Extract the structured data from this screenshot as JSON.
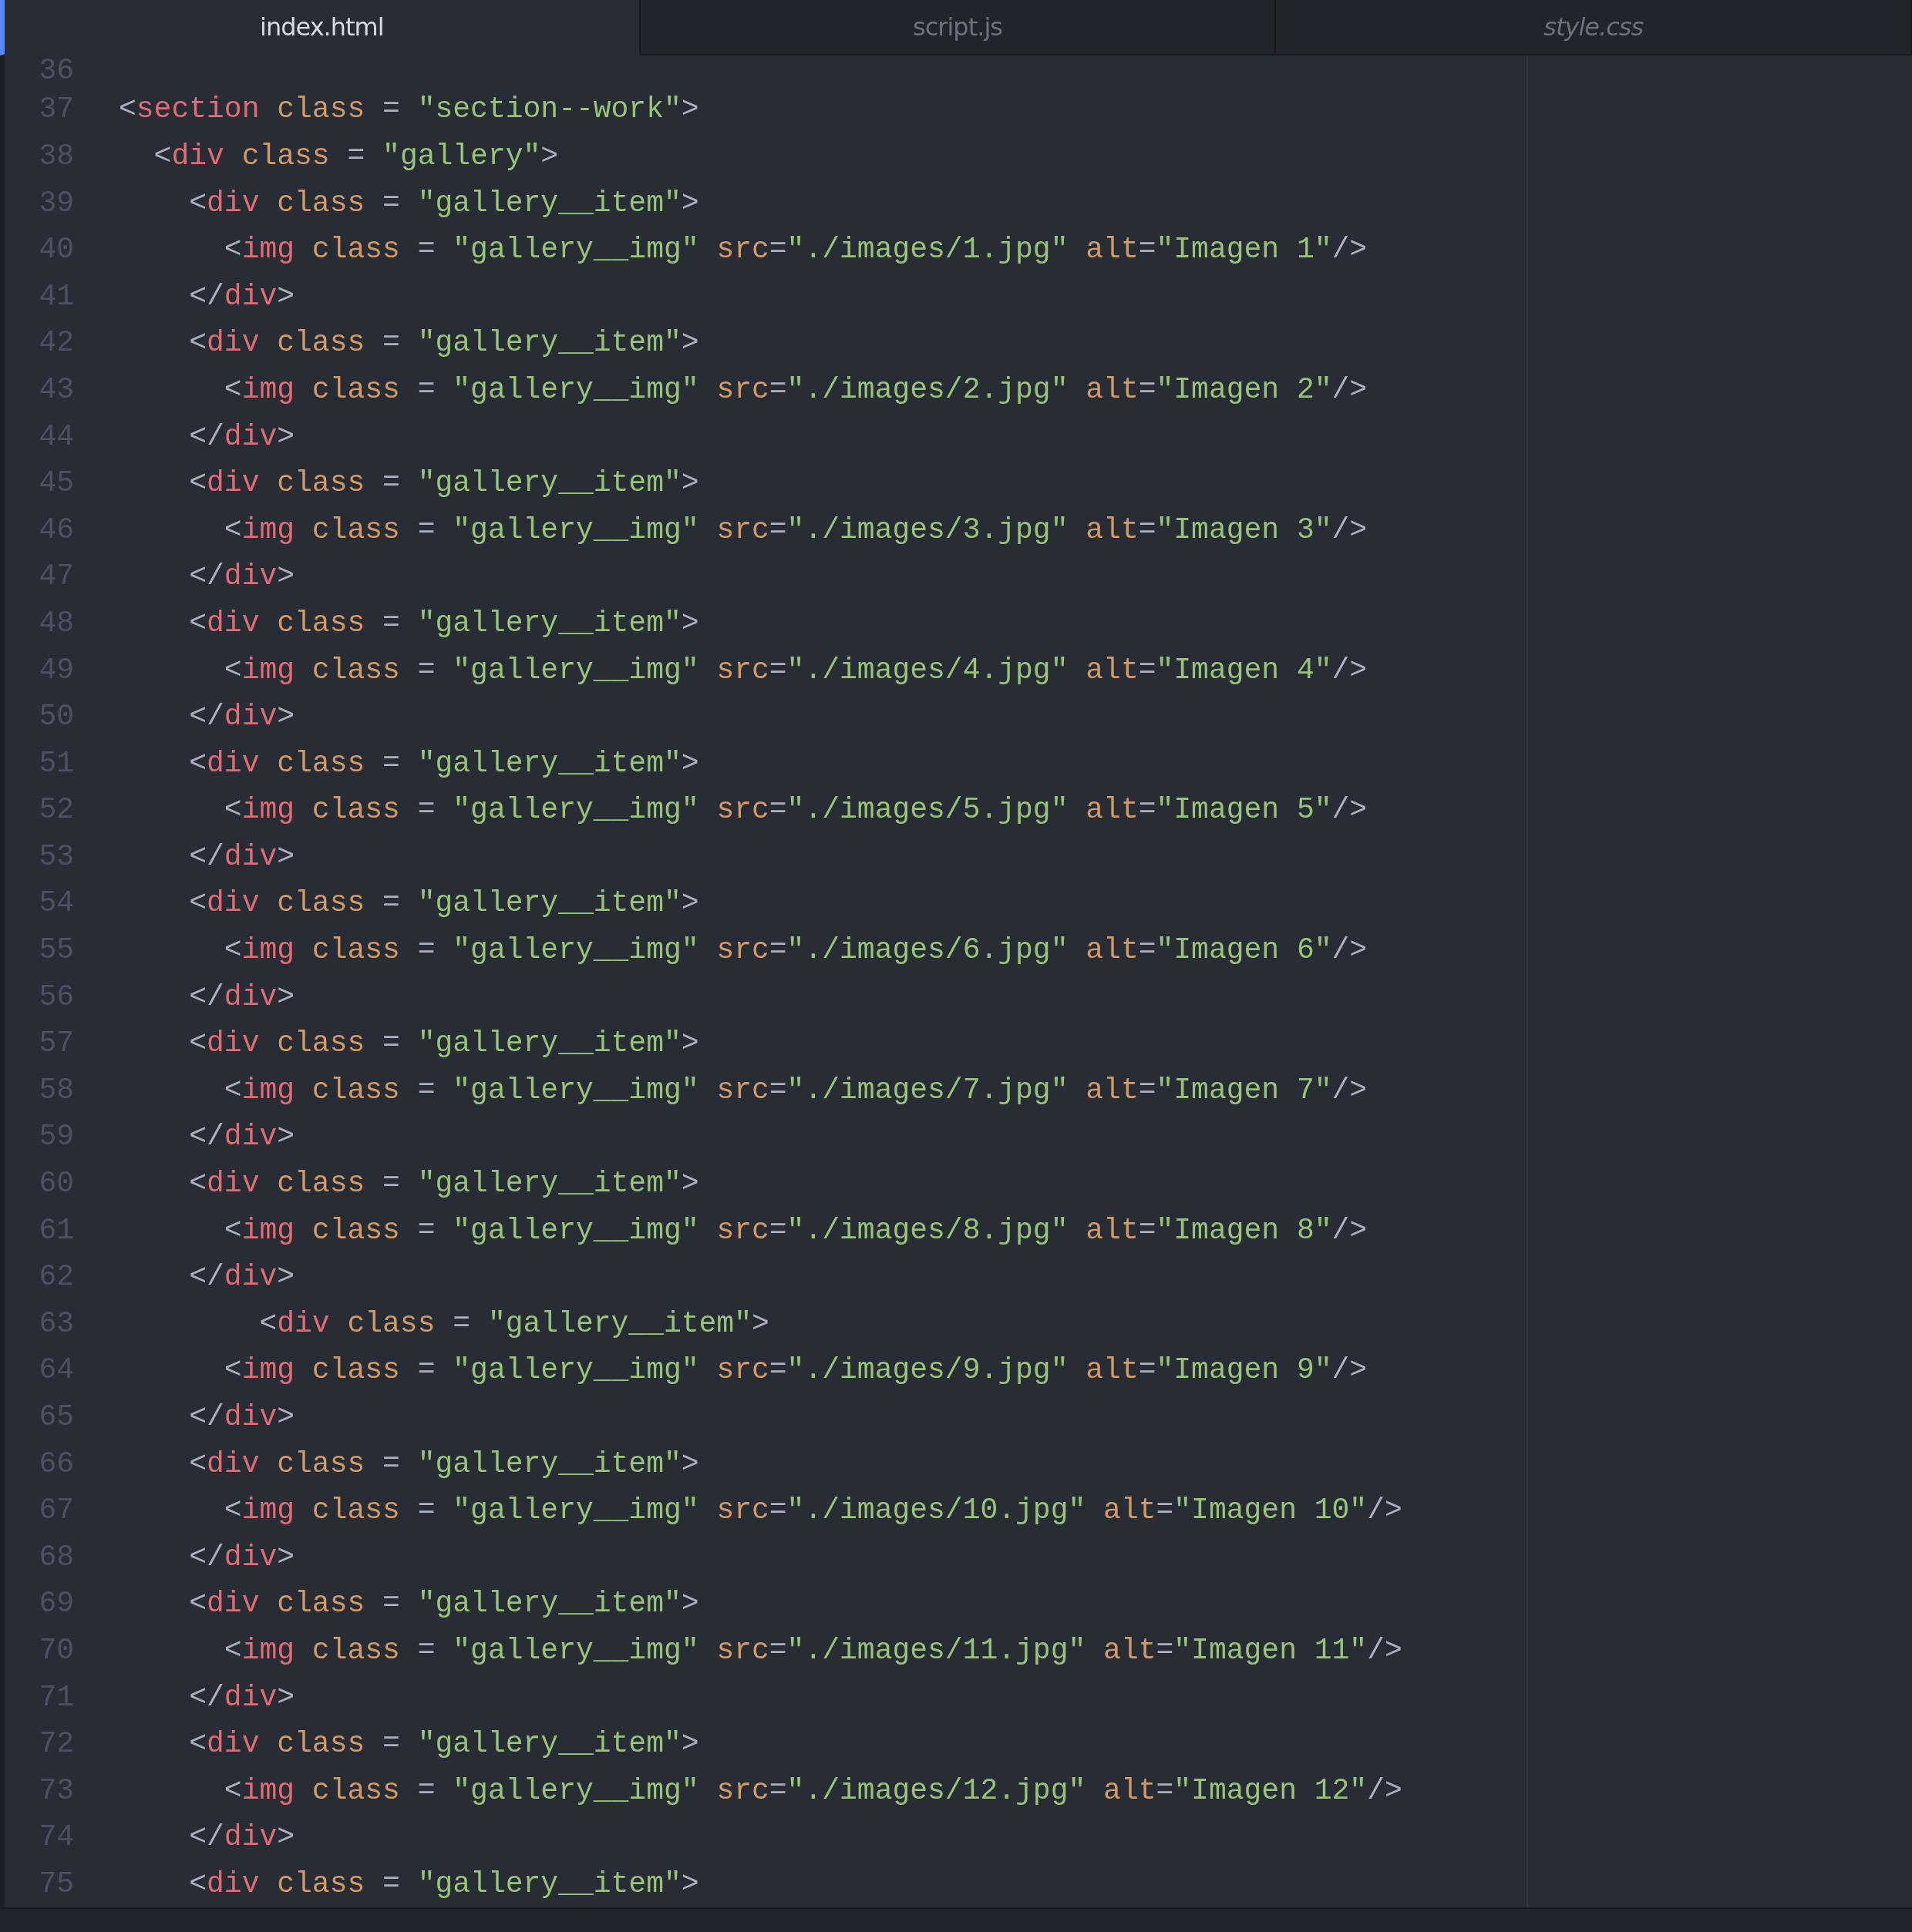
{
  "tabs": [
    {
      "label": "index.html",
      "selected": true,
      "pending": false
    },
    {
      "label": "script.js",
      "selected": false,
      "pending": false
    },
    {
      "label": "style.css",
      "selected": false,
      "pending": true
    }
  ],
  "editor": {
    "lines": [
      {
        "number": "36"
      },
      {
        "number": "37",
        "tokens": [
          {
            "kind": "punct",
            "text": "<"
          },
          {
            "kind": "tag",
            "text": "section"
          },
          {
            "kind": "attr",
            "text": " class"
          },
          {
            "kind": "punct",
            "text": " = "
          },
          {
            "kind": "string",
            "text": "\"section--work\""
          },
          {
            "kind": "punct",
            "text": ">"
          }
        ]
      },
      {
        "number": "38",
        "tokens": [
          {
            "kind": "punct",
            "text": "  <"
          },
          {
            "kind": "tag",
            "text": "div"
          },
          {
            "kind": "attr",
            "text": " class"
          },
          {
            "kind": "punct",
            "text": " = "
          },
          {
            "kind": "string",
            "text": "\"gallery\""
          },
          {
            "kind": "punct",
            "text": ">"
          }
        ]
      },
      {
        "number": "39",
        "tokens": [
          {
            "kind": "punct",
            "text": "    <"
          },
          {
            "kind": "tag",
            "text": "div"
          },
          {
            "kind": "attr",
            "text": " class"
          },
          {
            "kind": "punct",
            "text": " = "
          },
          {
            "kind": "string",
            "text": "\"gallery__item\""
          },
          {
            "kind": "punct",
            "text": ">"
          }
        ]
      },
      {
        "number": "40",
        "tokens": [
          {
            "kind": "punct",
            "text": "      <"
          },
          {
            "kind": "tag",
            "text": "img"
          },
          {
            "kind": "attr",
            "text": " class"
          },
          {
            "kind": "punct",
            "text": " = "
          },
          {
            "kind": "string",
            "text": "\"gallery__img\""
          },
          {
            "kind": "attr",
            "text": " src"
          },
          {
            "kind": "punct",
            "text": "="
          },
          {
            "kind": "string",
            "text": "\"./images/1.jpg\""
          },
          {
            "kind": "attr",
            "text": " alt"
          },
          {
            "kind": "punct",
            "text": "="
          },
          {
            "kind": "string",
            "text": "\"Imagen 1\""
          },
          {
            "kind": "punct",
            "text": "/>"
          }
        ]
      },
      {
        "number": "41",
        "tokens": [
          {
            "kind": "punct",
            "text": "    </"
          },
          {
            "kind": "tag",
            "text": "div"
          },
          {
            "kind": "punct",
            "text": ">"
          }
        ]
      },
      {
        "number": "42",
        "tokens": [
          {
            "kind": "punct",
            "text": "    <"
          },
          {
            "kind": "tag",
            "text": "div"
          },
          {
            "kind": "attr",
            "text": " class"
          },
          {
            "kind": "punct",
            "text": " = "
          },
          {
            "kind": "string",
            "text": "\"gallery__item\""
          },
          {
            "kind": "punct",
            "text": ">"
          }
        ]
      },
      {
        "number": "43",
        "tokens": [
          {
            "kind": "punct",
            "text": "      <"
          },
          {
            "kind": "tag",
            "text": "img"
          },
          {
            "kind": "attr",
            "text": " class"
          },
          {
            "kind": "punct",
            "text": " = "
          },
          {
            "kind": "string",
            "text": "\"gallery__img\""
          },
          {
            "kind": "attr",
            "text": " src"
          },
          {
            "kind": "punct",
            "text": "="
          },
          {
            "kind": "string",
            "text": "\"./images/2.jpg\""
          },
          {
            "kind": "attr",
            "text": " alt"
          },
          {
            "kind": "punct",
            "text": "="
          },
          {
            "kind": "string",
            "text": "\"Imagen 2\""
          },
          {
            "kind": "punct",
            "text": "/>"
          }
        ]
      },
      {
        "number": "44",
        "tokens": [
          {
            "kind": "punct",
            "text": "    </"
          },
          {
            "kind": "tag",
            "text": "div"
          },
          {
            "kind": "punct",
            "text": ">"
          }
        ]
      },
      {
        "number": "45",
        "tokens": [
          {
            "kind": "punct",
            "text": "    <"
          },
          {
            "kind": "tag",
            "text": "div"
          },
          {
            "kind": "attr",
            "text": " class"
          },
          {
            "kind": "punct",
            "text": " = "
          },
          {
            "kind": "string",
            "text": "\"gallery__item\""
          },
          {
            "kind": "punct",
            "text": ">"
          }
        ]
      },
      {
        "number": "46",
        "tokens": [
          {
            "kind": "punct",
            "text": "      <"
          },
          {
            "kind": "tag",
            "text": "img"
          },
          {
            "kind": "attr",
            "text": " class"
          },
          {
            "kind": "punct",
            "text": " = "
          },
          {
            "kind": "string",
            "text": "\"gallery__img\""
          },
          {
            "kind": "attr",
            "text": " src"
          },
          {
            "kind": "punct",
            "text": "="
          },
          {
            "kind": "string",
            "text": "\"./images/3.jpg\""
          },
          {
            "kind": "attr",
            "text": " alt"
          },
          {
            "kind": "punct",
            "text": "="
          },
          {
            "kind": "string",
            "text": "\"Imagen 3\""
          },
          {
            "kind": "punct",
            "text": "/>"
          }
        ]
      },
      {
        "number": "47",
        "tokens": [
          {
            "kind": "punct",
            "text": "    </"
          },
          {
            "kind": "tag",
            "text": "div"
          },
          {
            "kind": "punct",
            "text": ">"
          }
        ]
      },
      {
        "number": "48",
        "tokens": [
          {
            "kind": "punct",
            "text": "    <"
          },
          {
            "kind": "tag",
            "text": "div"
          },
          {
            "kind": "attr",
            "text": " class"
          },
          {
            "kind": "punct",
            "text": " = "
          },
          {
            "kind": "string",
            "text": "\"gallery__item\""
          },
          {
            "kind": "punct",
            "text": ">"
          }
        ]
      },
      {
        "number": "49",
        "tokens": [
          {
            "kind": "punct",
            "text": "      <"
          },
          {
            "kind": "tag",
            "text": "img"
          },
          {
            "kind": "attr",
            "text": " class"
          },
          {
            "kind": "punct",
            "text": " = "
          },
          {
            "kind": "string",
            "text": "\"gallery__img\""
          },
          {
            "kind": "attr",
            "text": " src"
          },
          {
            "kind": "punct",
            "text": "="
          },
          {
            "kind": "string",
            "text": "\"./images/4.jpg\""
          },
          {
            "kind": "attr",
            "text": " alt"
          },
          {
            "kind": "punct",
            "text": "="
          },
          {
            "kind": "string",
            "text": "\"Imagen 4\""
          },
          {
            "kind": "punct",
            "text": "/>"
          }
        ]
      },
      {
        "number": "50",
        "tokens": [
          {
            "kind": "punct",
            "text": "    </"
          },
          {
            "kind": "tag",
            "text": "div"
          },
          {
            "kind": "punct",
            "text": ">"
          }
        ]
      },
      {
        "number": "51",
        "tokens": [
          {
            "kind": "punct",
            "text": "    <"
          },
          {
            "kind": "tag",
            "text": "div"
          },
          {
            "kind": "attr",
            "text": " class"
          },
          {
            "kind": "punct",
            "text": " = "
          },
          {
            "kind": "string",
            "text": "\"gallery__item\""
          },
          {
            "kind": "punct",
            "text": ">"
          }
        ]
      },
      {
        "number": "52",
        "tokens": [
          {
            "kind": "punct",
            "text": "      <"
          },
          {
            "kind": "tag",
            "text": "img"
          },
          {
            "kind": "attr",
            "text": " class"
          },
          {
            "kind": "punct",
            "text": " = "
          },
          {
            "kind": "string",
            "text": "\"gallery__img\""
          },
          {
            "kind": "attr",
            "text": " src"
          },
          {
            "kind": "punct",
            "text": "="
          },
          {
            "kind": "string",
            "text": "\"./images/5.jpg\""
          },
          {
            "kind": "attr",
            "text": " alt"
          },
          {
            "kind": "punct",
            "text": "="
          },
          {
            "kind": "string",
            "text": "\"Imagen 5\""
          },
          {
            "kind": "punct",
            "text": "/>"
          }
        ]
      },
      {
        "number": "53",
        "tokens": [
          {
            "kind": "punct",
            "text": "    </"
          },
          {
            "kind": "tag",
            "text": "div"
          },
          {
            "kind": "punct",
            "text": ">"
          }
        ]
      },
      {
        "number": "54",
        "tokens": [
          {
            "kind": "punct",
            "text": "    <"
          },
          {
            "kind": "tag",
            "text": "div"
          },
          {
            "kind": "attr",
            "text": " class"
          },
          {
            "kind": "punct",
            "text": " = "
          },
          {
            "kind": "string",
            "text": "\"gallery__item\""
          },
          {
            "kind": "punct",
            "text": ">"
          }
        ]
      },
      {
        "number": "55",
        "tokens": [
          {
            "kind": "punct",
            "text": "      <"
          },
          {
            "kind": "tag",
            "text": "img"
          },
          {
            "kind": "attr",
            "text": " class"
          },
          {
            "kind": "punct",
            "text": " = "
          },
          {
            "kind": "string",
            "text": "\"gallery__img\""
          },
          {
            "kind": "attr",
            "text": " src"
          },
          {
            "kind": "punct",
            "text": "="
          },
          {
            "kind": "string",
            "text": "\"./images/6.jpg\""
          },
          {
            "kind": "attr",
            "text": " alt"
          },
          {
            "kind": "punct",
            "text": "="
          },
          {
            "kind": "string",
            "text": "\"Imagen 6\""
          },
          {
            "kind": "punct",
            "text": "/>"
          }
        ]
      },
      {
        "number": "56",
        "tokens": [
          {
            "kind": "punct",
            "text": "    </"
          },
          {
            "kind": "tag",
            "text": "div"
          },
          {
            "kind": "punct",
            "text": ">"
          }
        ]
      },
      {
        "number": "57",
        "tokens": [
          {
            "kind": "punct",
            "text": "    <"
          },
          {
            "kind": "tag",
            "text": "div"
          },
          {
            "kind": "attr",
            "text": " class"
          },
          {
            "kind": "punct",
            "text": " = "
          },
          {
            "kind": "string",
            "text": "\"gallery__item\""
          },
          {
            "kind": "punct",
            "text": ">"
          }
        ]
      },
      {
        "number": "58",
        "tokens": [
          {
            "kind": "punct",
            "text": "      <"
          },
          {
            "kind": "tag",
            "text": "img"
          },
          {
            "kind": "attr",
            "text": " class"
          },
          {
            "kind": "punct",
            "text": " = "
          },
          {
            "kind": "string",
            "text": "\"gallery__img\""
          },
          {
            "kind": "attr",
            "text": " src"
          },
          {
            "kind": "punct",
            "text": "="
          },
          {
            "kind": "string",
            "text": "\"./images/7.jpg\""
          },
          {
            "kind": "attr",
            "text": " alt"
          },
          {
            "kind": "punct",
            "text": "="
          },
          {
            "kind": "string",
            "text": "\"Imagen 7\""
          },
          {
            "kind": "punct",
            "text": "/>"
          }
        ]
      },
      {
        "number": "59",
        "tokens": [
          {
            "kind": "punct",
            "text": "    </"
          },
          {
            "kind": "tag",
            "text": "div"
          },
          {
            "kind": "punct",
            "text": ">"
          }
        ]
      },
      {
        "number": "60",
        "tokens": [
          {
            "kind": "punct",
            "text": "    <"
          },
          {
            "kind": "tag",
            "text": "div"
          },
          {
            "kind": "attr",
            "text": " class"
          },
          {
            "kind": "punct",
            "text": " = "
          },
          {
            "kind": "string",
            "text": "\"gallery__item\""
          },
          {
            "kind": "punct",
            "text": ">"
          }
        ]
      },
      {
        "number": "61",
        "tokens": [
          {
            "kind": "punct",
            "text": "      <"
          },
          {
            "kind": "tag",
            "text": "img"
          },
          {
            "kind": "attr",
            "text": " class"
          },
          {
            "kind": "punct",
            "text": " = "
          },
          {
            "kind": "string",
            "text": "\"gallery__img\""
          },
          {
            "kind": "attr",
            "text": " src"
          },
          {
            "kind": "punct",
            "text": "="
          },
          {
            "kind": "string",
            "text": "\"./images/8.jpg\""
          },
          {
            "kind": "attr",
            "text": " alt"
          },
          {
            "kind": "punct",
            "text": "="
          },
          {
            "kind": "string",
            "text": "\"Imagen 8\""
          },
          {
            "kind": "punct",
            "text": "/>"
          }
        ]
      },
      {
        "number": "62",
        "tokens": [
          {
            "kind": "punct",
            "text": "    </"
          },
          {
            "kind": "tag",
            "text": "div"
          },
          {
            "kind": "punct",
            "text": ">"
          }
        ]
      },
      {
        "number": "63",
        "tokens": [
          {
            "kind": "punct",
            "text": "        <"
          },
          {
            "kind": "tag",
            "text": "div"
          },
          {
            "kind": "attr",
            "text": " class"
          },
          {
            "kind": "punct",
            "text": " = "
          },
          {
            "kind": "string",
            "text": "\"gallery__item\""
          },
          {
            "kind": "punct",
            "text": ">"
          }
        ]
      },
      {
        "number": "64",
        "tokens": [
          {
            "kind": "punct",
            "text": "      <"
          },
          {
            "kind": "tag",
            "text": "img"
          },
          {
            "kind": "attr",
            "text": " class"
          },
          {
            "kind": "punct",
            "text": " = "
          },
          {
            "kind": "string",
            "text": "\"gallery__img\""
          },
          {
            "kind": "attr",
            "text": " src"
          },
          {
            "kind": "punct",
            "text": "="
          },
          {
            "kind": "string",
            "text": "\"./images/9.jpg\""
          },
          {
            "kind": "attr",
            "text": " alt"
          },
          {
            "kind": "punct",
            "text": "="
          },
          {
            "kind": "string",
            "text": "\"Imagen 9\""
          },
          {
            "kind": "punct",
            "text": "/>"
          }
        ]
      },
      {
        "number": "65",
        "tokens": [
          {
            "kind": "punct",
            "text": "    </"
          },
          {
            "kind": "tag",
            "text": "div"
          },
          {
            "kind": "punct",
            "text": ">"
          }
        ]
      },
      {
        "number": "66",
        "tokens": [
          {
            "kind": "punct",
            "text": "    <"
          },
          {
            "kind": "tag",
            "text": "div"
          },
          {
            "kind": "attr",
            "text": " class"
          },
          {
            "kind": "punct",
            "text": " = "
          },
          {
            "kind": "string",
            "text": "\"gallery__item\""
          },
          {
            "kind": "punct",
            "text": ">"
          }
        ]
      },
      {
        "number": "67",
        "tokens": [
          {
            "kind": "punct",
            "text": "      <"
          },
          {
            "kind": "tag",
            "text": "img"
          },
          {
            "kind": "attr",
            "text": " class"
          },
          {
            "kind": "punct",
            "text": " = "
          },
          {
            "kind": "string",
            "text": "\"gallery__img\""
          },
          {
            "kind": "attr",
            "text": " src"
          },
          {
            "kind": "punct",
            "text": "="
          },
          {
            "kind": "string",
            "text": "\"./images/10.jpg\""
          },
          {
            "kind": "attr",
            "text": " alt"
          },
          {
            "kind": "punct",
            "text": "="
          },
          {
            "kind": "string",
            "text": "\"Imagen 10\""
          },
          {
            "kind": "punct",
            "text": "/>"
          }
        ]
      },
      {
        "number": "68",
        "tokens": [
          {
            "kind": "punct",
            "text": "    </"
          },
          {
            "kind": "tag",
            "text": "div"
          },
          {
            "kind": "punct",
            "text": ">"
          }
        ]
      },
      {
        "number": "69",
        "tokens": [
          {
            "kind": "punct",
            "text": "    <"
          },
          {
            "kind": "tag",
            "text": "div"
          },
          {
            "kind": "attr",
            "text": " class"
          },
          {
            "kind": "punct",
            "text": " = "
          },
          {
            "kind": "string",
            "text": "\"gallery__item\""
          },
          {
            "kind": "punct",
            "text": ">"
          }
        ]
      },
      {
        "number": "70",
        "tokens": [
          {
            "kind": "punct",
            "text": "      <"
          },
          {
            "kind": "tag",
            "text": "img"
          },
          {
            "kind": "attr",
            "text": " class"
          },
          {
            "kind": "punct",
            "text": " = "
          },
          {
            "kind": "string",
            "text": "\"gallery__img\""
          },
          {
            "kind": "attr",
            "text": " src"
          },
          {
            "kind": "punct",
            "text": "="
          },
          {
            "kind": "string",
            "text": "\"./images/11.jpg\""
          },
          {
            "kind": "attr",
            "text": " alt"
          },
          {
            "kind": "punct",
            "text": "="
          },
          {
            "kind": "string",
            "text": "\"Imagen 11\""
          },
          {
            "kind": "punct",
            "text": "/>"
          }
        ]
      },
      {
        "number": "71",
        "tokens": [
          {
            "kind": "punct",
            "text": "    </"
          },
          {
            "kind": "tag",
            "text": "div"
          },
          {
            "kind": "punct",
            "text": ">"
          }
        ]
      },
      {
        "number": "72",
        "tokens": [
          {
            "kind": "punct",
            "text": "    <"
          },
          {
            "kind": "tag",
            "text": "div"
          },
          {
            "kind": "attr",
            "text": " class"
          },
          {
            "kind": "punct",
            "text": " = "
          },
          {
            "kind": "string",
            "text": "\"gallery__item\""
          },
          {
            "kind": "punct",
            "text": ">"
          }
        ]
      },
      {
        "number": "73",
        "tokens": [
          {
            "kind": "punct",
            "text": "      <"
          },
          {
            "kind": "tag",
            "text": "img"
          },
          {
            "kind": "attr",
            "text": " class"
          },
          {
            "kind": "punct",
            "text": " = "
          },
          {
            "kind": "string",
            "text": "\"gallery__img\""
          },
          {
            "kind": "attr",
            "text": " src"
          },
          {
            "kind": "punct",
            "text": "="
          },
          {
            "kind": "string",
            "text": "\"./images/12.jpg\""
          },
          {
            "kind": "attr",
            "text": " alt"
          },
          {
            "kind": "punct",
            "text": "="
          },
          {
            "kind": "string",
            "text": "\"Imagen 12\""
          },
          {
            "kind": "punct",
            "text": "/>"
          }
        ]
      },
      {
        "number": "74",
        "tokens": [
          {
            "kind": "punct",
            "text": "    </"
          },
          {
            "kind": "tag",
            "text": "div"
          },
          {
            "kind": "punct",
            "text": ">"
          }
        ]
      },
      {
        "number": "75",
        "tokens": [
          {
            "kind": "punct",
            "text": "    <"
          },
          {
            "kind": "tag",
            "text": "div"
          },
          {
            "kind": "attr",
            "text": " class"
          },
          {
            "kind": "punct",
            "text": " = "
          },
          {
            "kind": "string",
            "text": "\"gallery__item\""
          },
          {
            "kind": "punct",
            "text": ">"
          }
        ]
      }
    ]
  }
}
